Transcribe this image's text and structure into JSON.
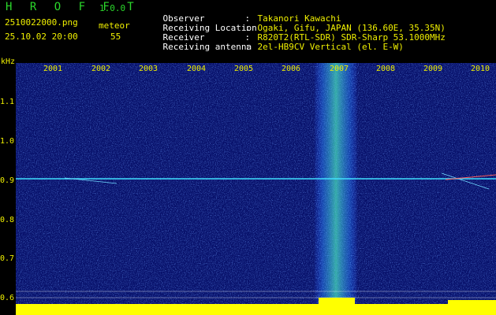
{
  "header": {
    "app_title": "H R O F F T",
    "app_version": "1.0.0",
    "filename": "2510022000.png",
    "datetime": "25.10.02 20:00",
    "meteor_label": "meteor",
    "meteor_count": "55"
  },
  "info": [
    {
      "key": "Observer",
      "sep": ":",
      "value": "Takanori Kawachi"
    },
    {
      "key": "Receiving Location",
      "sep": ":",
      "value": "Ogaki, Gifu, JAPAN (136.60E, 35.35N)"
    },
    {
      "key": "Receiver",
      "sep": ":",
      "value": "R820T2(RTL-SDR) SDR-Sharp 53.1000MHz"
    },
    {
      "key": "Receiving antenna",
      "sep": ":",
      "value": "2el-HB9CV Vertical (el. E-W)"
    }
  ],
  "axis": {
    "unit": "kHz",
    "y_ticks": [
      "1.1",
      "1.0",
      "0.9",
      "0.8",
      "0.7",
      "0.6"
    ],
    "x_ticks": [
      "2001",
      "2002",
      "2003",
      "2004",
      "2005",
      "2006",
      "2007",
      "2008",
      "2009",
      "2010"
    ]
  },
  "colors": {
    "background": "#000000",
    "spectrum_bg": "#08107a",
    "carrier_line": "#40e0ff",
    "noise_band": "#2aa8c8",
    "level_bar": "#ffff00",
    "label": "#f0f000",
    "title": "#2bd82b"
  }
}
